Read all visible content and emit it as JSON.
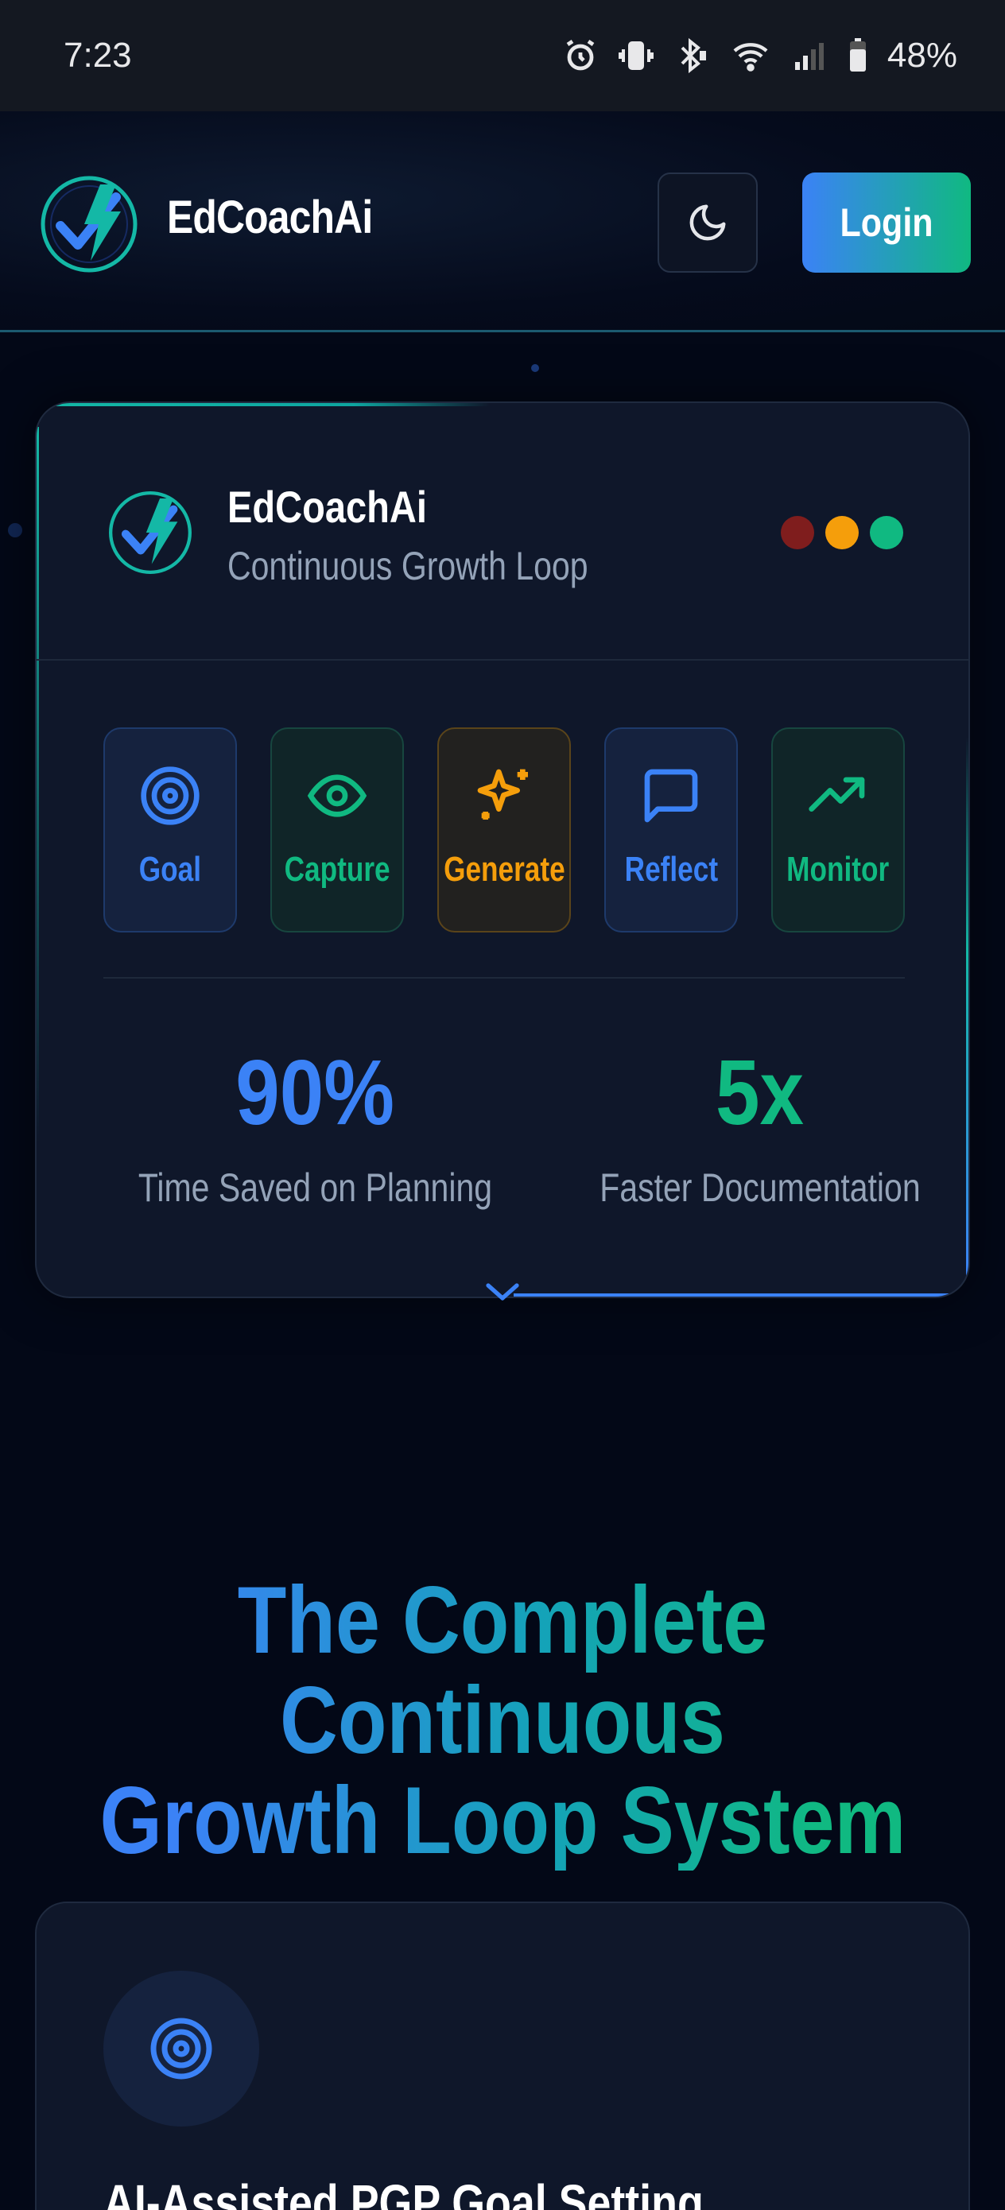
{
  "status_bar": {
    "time": "7:23",
    "battery": "48%",
    "icons": [
      "alarm-icon",
      "vibrate-icon",
      "bluetooth-icon",
      "wifi-icon",
      "signal-icon",
      "battery-icon"
    ]
  },
  "header": {
    "brand": "EdCoachAi",
    "login_label": "Login",
    "theme_icon": "moon-icon"
  },
  "hero_card": {
    "title": "EdCoachAi",
    "subtitle": "Continuous Growth Loop",
    "window_dots": [
      "#7f1d1d",
      "#f59e0b",
      "#10b981"
    ],
    "steps": [
      {
        "label": "Goal",
        "icon": "target-icon"
      },
      {
        "label": "Capture",
        "icon": "eye-icon"
      },
      {
        "label": "Generate",
        "icon": "sparkles-icon"
      },
      {
        "label": "Reflect",
        "icon": "message-icon"
      },
      {
        "label": "Monitor",
        "icon": "trending-up-icon"
      }
    ],
    "stats": [
      {
        "value": "90%",
        "caption": "Time Saved on Planning"
      },
      {
        "value": "5x",
        "caption": "Faster Documentation"
      }
    ]
  },
  "section": {
    "title_line1": "The Complete Continuous",
    "title_line2": "Growth Loop System"
  },
  "feature": {
    "icon": "target-icon",
    "title": "AI-Assisted PGP Goal Setting"
  },
  "colors": {
    "blue": "#3b82f6",
    "green": "#10b981",
    "amber": "#f59e0b",
    "background": "#030817",
    "card": "#0f172a"
  }
}
